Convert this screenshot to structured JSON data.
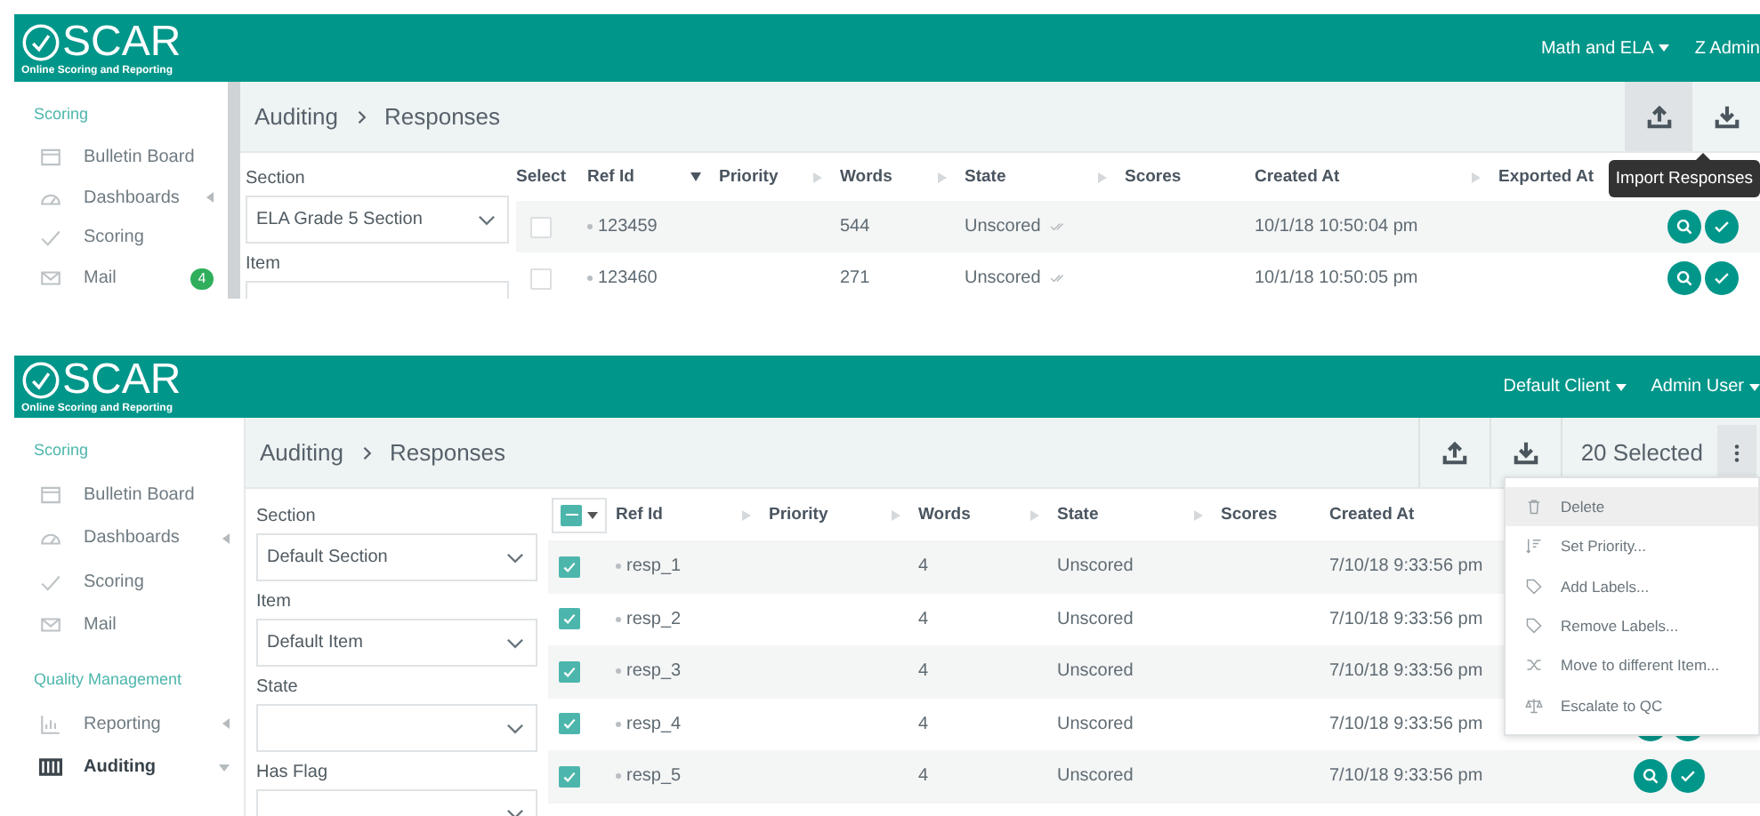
{
  "screens": [
    {
      "header": {
        "logo": "SCAR",
        "tagline": "Online Scoring and Reporting",
        "menus": [
          {
            "label": "Math and ELA",
            "dropdown": true
          },
          {
            "label": "Z Admin",
            "dropdown": false
          }
        ]
      },
      "sidebar": {
        "scrollbar": true,
        "sections": [
          {
            "title": "Scoring",
            "items": [
              {
                "kind": "board",
                "label": "Bulletin Board",
                "selected": false
              },
              {
                "kind": "dashboard",
                "label": "Dashboards",
                "selected": false,
                "expanded": false
              },
              {
                "kind": "scoring",
                "label": "Scoring",
                "selected": false
              },
              {
                "kind": "mail",
                "label": "Mail",
                "selected": false,
                "badge": "4"
              }
            ]
          }
        ]
      },
      "breadcrumb": [
        "Auditing",
        "Responses"
      ],
      "toolbar": {
        "buttons": [
          {
            "kind": "upload",
            "highlighted": true
          },
          {
            "kind": "download",
            "highlighted": false
          }
        ],
        "tooltip": "Import Responses"
      },
      "filters": [
        {
          "label": "Section",
          "value": "ELA Grade 5 Section"
        },
        {
          "label": "Item"
        }
      ],
      "table": {
        "select_header": {
          "kind": "text",
          "label": "Select"
        },
        "columns": [
          {
            "label": "Ref Id",
            "sorted": true
          },
          {
            "label": "Priority",
            "sorted": false
          },
          {
            "label": "Words",
            "sorted": false
          },
          {
            "label": "State",
            "sorted": false
          },
          {
            "label": "Scores"
          },
          {
            "label": "Created At",
            "sorted": false
          },
          {
            "label": "Exported At"
          }
        ],
        "rows": [
          {
            "selected": false,
            "ref_id": "123459",
            "words": "544",
            "state": "Unscored",
            "state_icon": true,
            "created_at": "10/1/18 10:50:04 pm"
          },
          {
            "selected": false,
            "ref_id": "123460",
            "words": "271",
            "state": "Unscored",
            "state_icon": true,
            "created_at": "10/1/18 10:50:05 pm"
          }
        ]
      }
    },
    {
      "header": {
        "logo": "SCAR",
        "tagline": "Online Scoring and Reporting",
        "menus": [
          {
            "label": "Default Client",
            "dropdown": true
          },
          {
            "label": "Admin User",
            "dropdown": true
          }
        ]
      },
      "sidebar": {
        "sections": [
          {
            "title": "Scoring",
            "items": [
              {
                "kind": "board",
                "label": "Bulletin Board",
                "selected": false
              },
              {
                "kind": "dashboard",
                "label": "Dashboards",
                "selected": false,
                "expanded": false
              },
              {
                "kind": "scoring",
                "label": "Scoring",
                "selected": false
              },
              {
                "kind": "mail",
                "label": "Mail",
                "selected": false
              }
            ]
          },
          {
            "title": "Quality Management",
            "items": [
              {
                "kind": "reporting",
                "label": "Reporting",
                "selected": false,
                "expanded": false
              },
              {
                "kind": "auditing",
                "label": "Auditing",
                "selected": true,
                "expanded": true
              }
            ]
          }
        ]
      },
      "breadcrumb": [
        "Auditing",
        "Responses"
      ],
      "toolbar": {
        "buttons": [
          {
            "kind": "upload",
            "highlighted": false
          },
          {
            "kind": "download",
            "highlighted": false
          }
        ],
        "selection_count": "20 Selected",
        "more": {
          "highlighted": true
        },
        "menu": [
          {
            "kind": "delete",
            "label": "Delete",
            "highlighted": true
          },
          {
            "kind": "priority",
            "label": "Set Priority...",
            "highlighted": false
          },
          {
            "kind": "tag",
            "label": "Add Labels...",
            "highlighted": false
          },
          {
            "kind": "tag",
            "label": "Remove Labels...",
            "highlighted": false
          },
          {
            "kind": "move",
            "label": "Move to different Item...",
            "highlighted": false
          },
          {
            "kind": "escalate",
            "label": "Escalate to QC",
            "highlighted": false
          }
        ]
      },
      "filters": [
        {
          "label": "Section",
          "value": "Default Section"
        },
        {
          "label": "Item",
          "value": "Default Item"
        },
        {
          "label": "State"
        },
        {
          "label": "Has Flag"
        }
      ],
      "table": {
        "select_header": {
          "kind": "checkbox",
          "indeterminate": true
        },
        "columns": [
          {
            "label": "Ref Id",
            "sorted": false
          },
          {
            "label": "Priority",
            "sorted": false
          },
          {
            "label": "Words",
            "sorted": false
          },
          {
            "label": "State",
            "sorted": false
          },
          {
            "label": "Scores"
          },
          {
            "label": "Created At"
          }
        ],
        "rows": [
          {
            "selected": true,
            "ref_id": "resp_1",
            "words": "4",
            "state": "Unscored",
            "created_at": "7/10/18 9:33:56 pm"
          },
          {
            "selected": true,
            "ref_id": "resp_2",
            "words": "4",
            "state": "Unscored",
            "created_at": "7/10/18 9:33:56 pm"
          },
          {
            "selected": true,
            "ref_id": "resp_3",
            "words": "4",
            "state": "Unscored",
            "created_at": "7/10/18 9:33:56 pm"
          },
          {
            "selected": true,
            "ref_id": "resp_4",
            "words": "4",
            "state": "Unscored",
            "created_at": "7/10/18 9:33:56 pm"
          },
          {
            "selected": true,
            "ref_id": "resp_5",
            "words": "4",
            "state": "Unscored",
            "created_at": "7/10/18 9:33:56 pm"
          }
        ]
      }
    }
  ]
}
